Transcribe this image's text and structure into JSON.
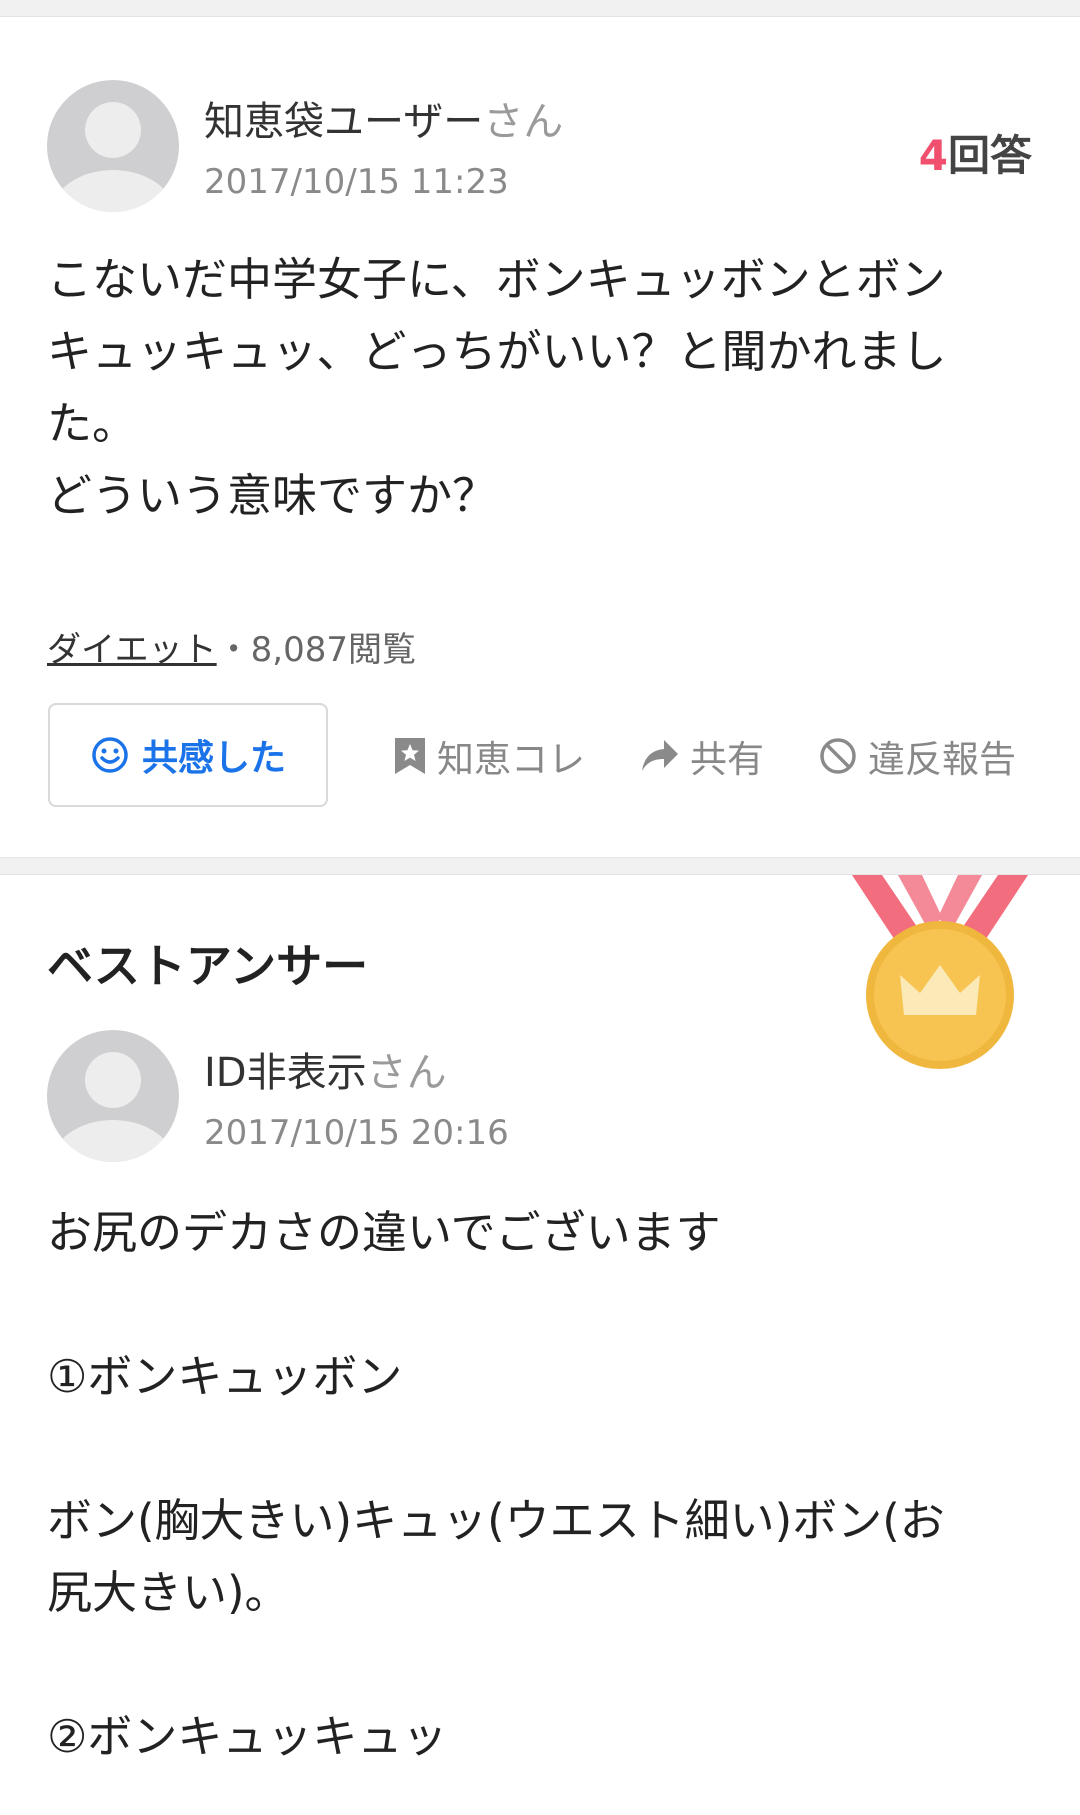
{
  "question": {
    "user_name": "知恵袋ユーザー",
    "user_suffix": "さん",
    "date": "2017/10/15 11:23",
    "answer_count_num": "4",
    "answer_count_label": "回答",
    "text": "こないだ中学女子に、ボンキュッボンとボン\nキュッキュッ、どっちがいい？と聞かれまし\nた。\nどういう意味ですか？",
    "category": "ダイエット",
    "separator": "・",
    "views": "8,087閲覧",
    "empathy_label": "共感した",
    "actions": {
      "chiecolle": "知恵コレ",
      "share": "共有",
      "report": "違反報告"
    }
  },
  "best_answer": {
    "title": "ベストアンサー",
    "user_name": "ID非表示",
    "user_suffix": "さん",
    "date": "2017/10/15 20:16",
    "text": "お尻のデカさの違いでございます\n\n①ボンキュッボン\n\nボン(胸大きい)キュッ(ウエスト細い)ボン(お\n尻大きい)。\n\n②ボンキュッキュッ"
  },
  "colors": {
    "accent_pink": "#f0506e",
    "link_blue": "#1a73e8",
    "medal_gold": "#f5c24f",
    "ribbon": "#f26d7d"
  },
  "icons": [
    "smile-icon",
    "bookmark-star-icon",
    "share-arrow-icon",
    "prohibit-icon",
    "medal-icon"
  ]
}
